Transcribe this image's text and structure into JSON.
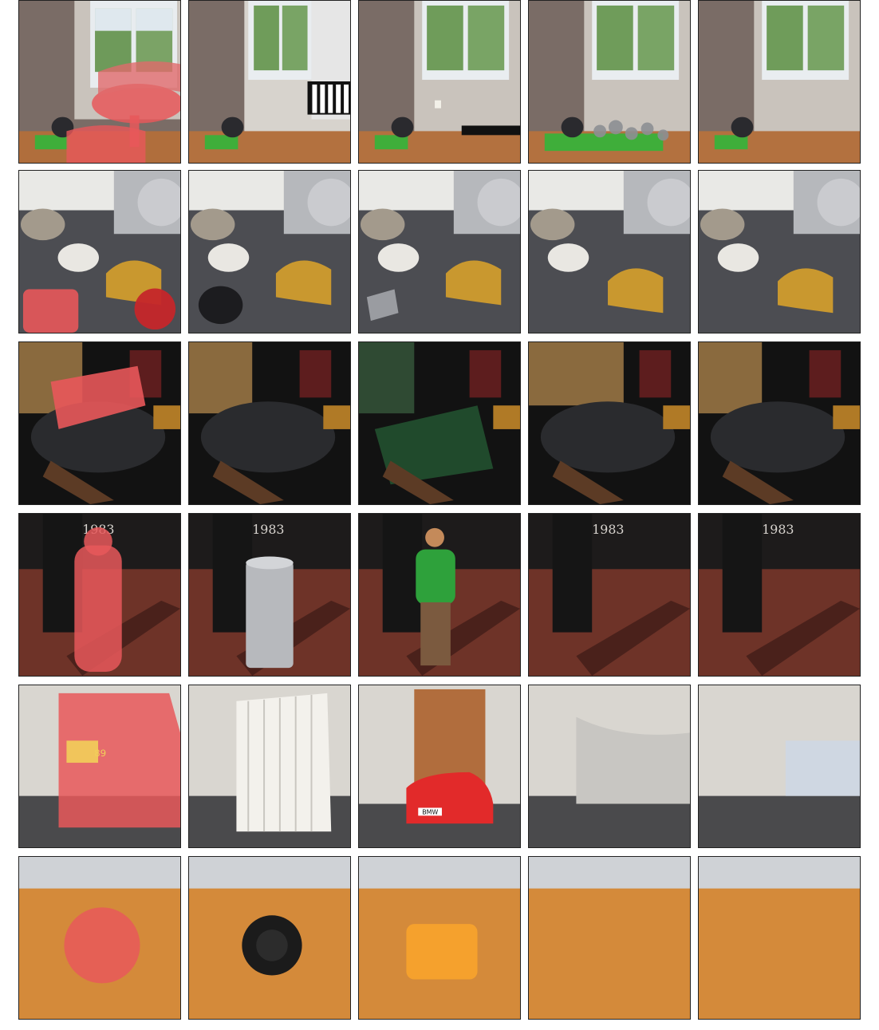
{
  "figure": {
    "rows": [
      {
        "scene": "interior-window-with-cat",
        "columns": [
          "mask",
          "replace-a",
          "replace-b",
          "remove-a",
          "remove-b"
        ],
        "mask_color": "#e8585a"
      },
      {
        "scene": "kitchen-mixer-bananas",
        "columns": [
          "mask",
          "replace-a",
          "replace-b",
          "remove-a",
          "remove-b"
        ],
        "mask_color": "#e8585a"
      },
      {
        "scene": "cake-on-glass-plate",
        "columns": [
          "mask",
          "replace-a",
          "replace-b",
          "remove-a",
          "remove-b"
        ],
        "mask_color": "#e8585a"
      },
      {
        "scene": "sidewalk-fire-hydrant",
        "columns": [
          "mask",
          "replace-a",
          "replace-b",
          "remove-a",
          "remove-b"
        ],
        "mask_color": "#e8585a",
        "label_text": "1983"
      },
      {
        "scene": "street-double-decker-bus",
        "columns": [
          "mask",
          "replace-a",
          "replace-b",
          "remove-a",
          "remove-b"
        ],
        "mask_color": "#e8585a",
        "bus_number": "89",
        "car_plate": "BMW"
      },
      {
        "scene": "baseball-glove",
        "columns": [
          "mask",
          "replace-a",
          "replace-b",
          "remove-a",
          "remove-b"
        ],
        "mask_color": "#e8585a"
      }
    ]
  }
}
